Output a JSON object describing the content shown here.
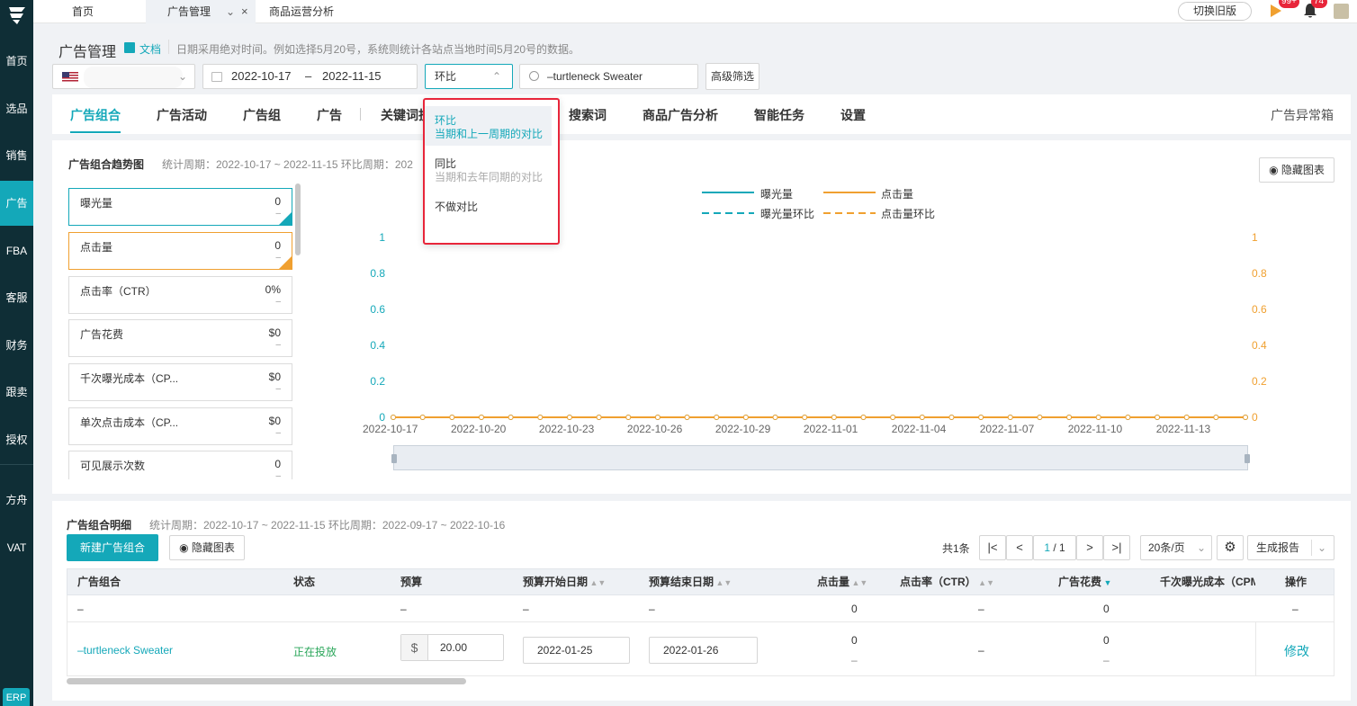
{
  "sidebar": {
    "items": [
      {
        "label": "首页"
      },
      {
        "label": "选品"
      },
      {
        "label": "销售"
      },
      {
        "label": "广告"
      },
      {
        "label": "FBA"
      },
      {
        "label": "客服"
      },
      {
        "label": "财务"
      },
      {
        "label": "跟卖"
      },
      {
        "label": "授权"
      },
      {
        "label": "方舟"
      },
      {
        "label": "VAT"
      }
    ],
    "erp_label": "ERP"
  },
  "topbar": {
    "tabs": [
      {
        "label": "首页"
      },
      {
        "label": "广告管理"
      },
      {
        "label": "商品运营分析"
      }
    ],
    "switch_label": "切换旧版",
    "badge_flag": "99+",
    "badge_bell": "74"
  },
  "header": {
    "title": "广告管理",
    "doc_link": "文档",
    "note": "日期采用绝对时间。例如选择5月20号，系统则统计各站点当地时间5月20号的数据。"
  },
  "filters": {
    "date_start": "2022-10-17",
    "date_sep": "–",
    "date_end": "2022-11-15",
    "compare_value": "环比",
    "search_value": "–turtleneck Sweater",
    "advanced_label": "高级筛选"
  },
  "dropdown": {
    "options": [
      {
        "label": "环比",
        "desc": "当期和上一周期的对比"
      },
      {
        "label": "同比",
        "desc": "当期和去年同期的对比"
      },
      {
        "label": "不做对比",
        "desc": ""
      }
    ]
  },
  "navtabs": {
    "items": [
      {
        "label": "广告组合"
      },
      {
        "label": "广告活动"
      },
      {
        "label": "广告组"
      },
      {
        "label": "广告"
      },
      {
        "label": "关键词投"
      },
      {
        "label": "搜索词"
      },
      {
        "label": "商品广告分析"
      },
      {
        "label": "智能任务"
      },
      {
        "label": "设置"
      }
    ],
    "right_label": "广告异常箱"
  },
  "trend": {
    "title": "广告组合趋势图",
    "period": "统计周期：2022-10-17 ~ 2022-11-15 环比周期：202",
    "hide_chart": "隐藏图表",
    "metrics": [
      {
        "label": "曝光量",
        "value": "0",
        "cmp": "–"
      },
      {
        "label": "点击量",
        "value": "0",
        "cmp": "–"
      },
      {
        "label": "点击率（CTR）",
        "value": "0%",
        "cmp": "–"
      },
      {
        "label": "广告花费",
        "value": "$0",
        "cmp": "–"
      },
      {
        "label": "千次曝光成本（CP...",
        "value": "$0",
        "cmp": "–"
      },
      {
        "label": "单次点击成本（CP...",
        "value": "$0",
        "cmp": "–"
      },
      {
        "label": "可见展示次数",
        "value": "0",
        "cmp": "–"
      }
    ]
  },
  "chart_data": {
    "type": "line",
    "x": [
      "2022-10-17",
      "2022-10-18",
      "2022-10-19",
      "2022-10-20",
      "2022-10-21",
      "2022-10-22",
      "2022-10-23",
      "2022-10-24",
      "2022-10-25",
      "2022-10-26",
      "2022-10-27",
      "2022-10-28",
      "2022-10-29",
      "2022-10-30",
      "2022-10-31",
      "2022-11-01",
      "2022-11-02",
      "2022-11-03",
      "2022-11-04",
      "2022-11-05",
      "2022-11-06",
      "2022-11-07",
      "2022-11-08",
      "2022-11-09",
      "2022-11-10",
      "2022-11-11",
      "2022-11-12",
      "2022-11-13",
      "2022-11-14",
      "2022-11-15"
    ],
    "x_tick_labels": [
      "2022-10-17",
      "2022-10-20",
      "2022-10-23",
      "2022-10-26",
      "2022-10-29",
      "2022-11-01",
      "2022-11-04",
      "2022-11-07",
      "2022-11-10",
      "2022-11-13"
    ],
    "series": [
      {
        "name": "曝光量",
        "color": "#14a8b9",
        "dash": false,
        "values": [
          0,
          0,
          0,
          0,
          0,
          0,
          0,
          0,
          0,
          0,
          0,
          0,
          0,
          0,
          0,
          0,
          0,
          0,
          0,
          0,
          0,
          0,
          0,
          0,
          0,
          0,
          0,
          0,
          0,
          0
        ]
      },
      {
        "name": "点击量",
        "color": "#f0a030",
        "dash": false,
        "values": [
          0,
          0,
          0,
          0,
          0,
          0,
          0,
          0,
          0,
          0,
          0,
          0,
          0,
          0,
          0,
          0,
          0,
          0,
          0,
          0,
          0,
          0,
          0,
          0,
          0,
          0,
          0,
          0,
          0,
          0
        ]
      },
      {
        "name": "曝光量环比",
        "color": "#14a8b9",
        "dash": true,
        "values": []
      },
      {
        "name": "点击量环比",
        "color": "#f0a030",
        "dash": true,
        "values": []
      }
    ],
    "y_ticks": [
      "0",
      "0.2",
      "0.4",
      "0.6",
      "0.8",
      "1"
    ],
    "ylim": [
      0,
      1
    ],
    "grid": false,
    "legend": "top-center"
  },
  "detail": {
    "title": "广告组合明细",
    "period": "统计周期：2022-10-17 ~ 2022-11-15 环比周期：2022-09-17 ~ 2022-10-16",
    "new_button": "新建广告组合",
    "hide_chart": "隐藏图表",
    "total": "共1条",
    "page_current": "1",
    "page_total": "/ 1",
    "page_size": "20条/页",
    "report": "生成报告",
    "columns": [
      "广告组合",
      "状态",
      "预算",
      "预算开始日期",
      "预算结束日期",
      "点击量",
      "点击率（CTR）",
      "广告花费",
      "千次曝光成本（CPM",
      "操作"
    ],
    "summary_row": [
      "–",
      "",
      "–",
      "–",
      "–",
      "0",
      "–",
      "0",
      "",
      "–"
    ],
    "row": {
      "name": "–turtleneck Sweater",
      "status": "正在投放",
      "currency": "$",
      "budget": "20.00",
      "start": "2022-01-25",
      "end": "2022-01-26",
      "clicks": "0",
      "clicks_cmp": "–",
      "ctr": "–",
      "spend": "0",
      "spend_cmp": "–",
      "action": "修改"
    }
  },
  "colors": {
    "accent": "#14a8b9",
    "orange": "#f0a030",
    "sidebar": "#0f2e36",
    "highlight": "#e8253a"
  }
}
